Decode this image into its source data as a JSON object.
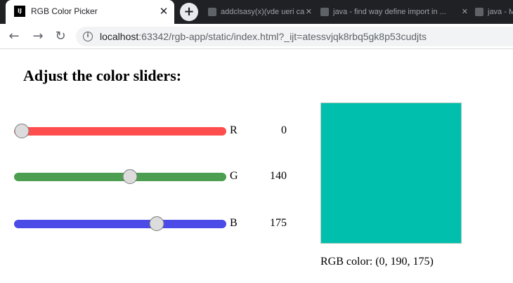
{
  "browser": {
    "active_tab": {
      "title": "RGB Color Picker",
      "favicon": "IJ"
    },
    "background_tabs": [
      {
        "title": "addclsasy(x)(vde ueri ca"
      },
      {
        "title": "java - find way define import in ..."
      },
      {
        "title": "java - Meta"
      }
    ],
    "url_host": "localhost",
    "url_rest": ":63342/rgb-app/static/index.html?_ijt=atessvjqk8rbq5gk8p53cudjts"
  },
  "page": {
    "title": "Adjust the color sliders:",
    "sliders": [
      {
        "channel": "R",
        "value": "0",
        "level": 0,
        "track_color": "#ff4d4d"
      },
      {
        "channel": "G",
        "value": "140",
        "level": 0.549,
        "track_color": "#4c9f50"
      },
      {
        "channel": "B",
        "value": "175",
        "level": 0.686,
        "track_color": "#4b4be8"
      }
    ],
    "swatch_color": "#00bfad",
    "rgb_readout": "RGB color: (0, 190, 175)"
  }
}
